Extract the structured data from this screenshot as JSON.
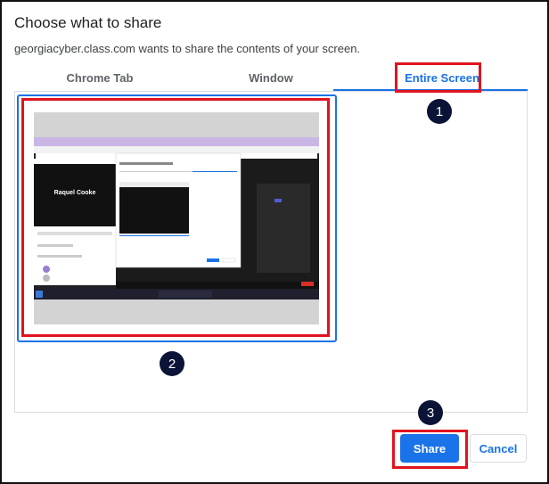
{
  "dialog": {
    "title": "Choose what to share",
    "subtitle": "georgiacyber.class.com wants to share the contents of your screen."
  },
  "tabs": [
    {
      "label": "Chrome Tab",
      "selected": false
    },
    {
      "label": "Window",
      "selected": false
    },
    {
      "label": "Entire Screen",
      "selected": true
    }
  ],
  "thumbnail": {
    "participant_name": "Raquel Cooke"
  },
  "steps": [
    "1",
    "2",
    "3"
  ],
  "buttons": {
    "share": "Share",
    "cancel": "Cancel"
  },
  "colors": {
    "accent": "#1a73e8",
    "highlight": "#e0141e",
    "step_badge": "#0b1437"
  }
}
